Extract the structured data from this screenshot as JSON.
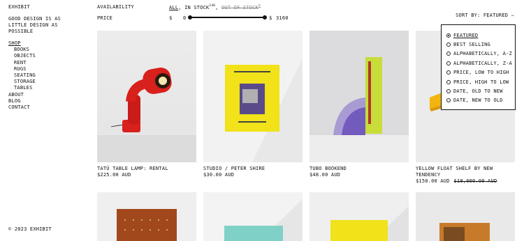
{
  "brand": "EXHIBIT",
  "tagline": "GOOD DESIGN IS AS LITTLE DESIGN AS POSSIBLE",
  "nav": {
    "shop": "SHOP",
    "shop_items": [
      "BOOKS",
      "OBJECTS",
      "RENT",
      "RUGS",
      "SEATING",
      "STORAGE",
      "TABLES"
    ],
    "other": [
      "ABOUT",
      "BLOG",
      "CONTACT"
    ]
  },
  "footer": "© 2023 EXHIBIT",
  "filters": {
    "availability_label": "AVAILABILITY",
    "all": "ALL",
    "in_stock": "IN STOCK",
    "in_stock_count": "146",
    "out_of_stock": "OUT OF STOCK",
    "out_of_stock_count": "0",
    "price_label": "PRICE",
    "currency": "$",
    "price_min": "0",
    "price_max": "3160"
  },
  "sort": {
    "button_label": "SORT BY: FEATURED —",
    "options": [
      "FEATURED",
      "BEST SELLING",
      "ALPHABETICALLY, A-Z",
      "ALPHABETICALLY, Z-A",
      "PRICE, LOW TO HIGH",
      "PRICE, HIGH TO LOW",
      "DATE, OLD TO NEW",
      "DATE, NEW TO OLD"
    ],
    "selected_index": 0
  },
  "products": [
    {
      "name": "TATÙ TABLE LAMP: RENTAL",
      "price": "$225.00 AUD",
      "was": ""
    },
    {
      "name": "STUDIO / PETER SHIRE",
      "price": "$30.00 AUD",
      "was": ""
    },
    {
      "name": "TUBO BOOKEND",
      "price": "$48.00 AUD",
      "was": ""
    },
    {
      "name": "YELLOW FLOAT SHELF BY NEW TENDENCY",
      "price": "$150.00 AUD",
      "was": "$19,000.00 AUD"
    }
  ],
  "colors": {
    "lamp_red": "#d8201c",
    "book_yellow": "#f1e21a",
    "book_green": "#c8dc3a",
    "shelf_yellow": "#f2b40d",
    "product_bg": "#e6e6e6",
    "tile_brown": "#a2481d",
    "book_teal": "#7fd1c8"
  }
}
